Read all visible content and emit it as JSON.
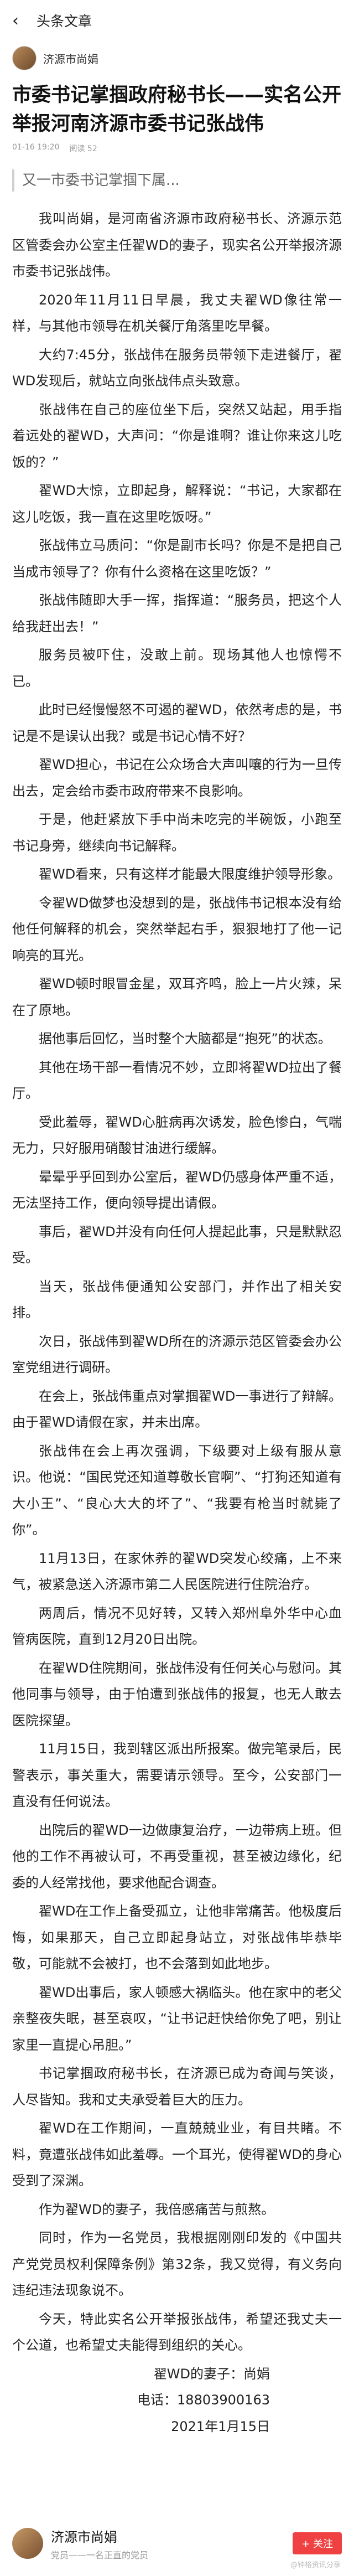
{
  "header": {
    "back_icon": "chevron-left-icon",
    "title": "头条文章"
  },
  "author": {
    "name": "济源市尚娟"
  },
  "article": {
    "title": "市委书记掌掴政府秘书长——实名公开举报河南济源市委书记张战伟",
    "date": "01-16 19:20",
    "reads": "阅读 52",
    "quote": "又一市委书记掌掴下属...",
    "paragraphs": [
      "我叫尚娟，是河南省济源市政府秘书长、济源示范区管委会办公室主任翟WD的妻子，现实名公开举报济源市委书记张战伟。",
      "2020年11月11日早晨，我丈夫翟WD像往常一样，与其他市领导在机关餐厅角落里吃早餐。",
      "大约7:45分，张战伟在服务员带领下走进餐厅，翟WD发现后，就站立向张战伟点头致意。",
      "张战伟在自己的座位坐下后，突然又站起，用手指着远处的翟WD，大声问：“你是谁啊？谁让你来这儿吃饭的？”",
      "翟WD大惊，立即起身，解释说：“书记，大家都在这儿吃饭，我一直在这里吃饭呀。”",
      "张战伟立马质问：“你是副市长吗？你是不是把自己当成市领导了？你有什么资格在这里吃饭？”",
      "张战伟随即大手一挥，指挥道：“服务员，把这个人给我赶出去！”",
      "服务员被吓住，没敢上前。现场其他人也惊愕不已。",
      "此时已经慢慢怒不可遏的翟WD，依然考虑的是，书记是不是误认出我？或是书记心情不好？",
      "翟WD担心，书记在公众场合大声叫嚷的行为一旦传出去，定会给市委市政府带来不良影响。",
      "于是，他赶紧放下手中尚未吃完的半碗饭，小跑至书记身旁，继续向书记解释。",
      "翟WD看来，只有这样才能最大限度维护领导形象。",
      "令翟WD做梦也没想到的是，张战伟书记根本没有给他任何解释的机会，突然举起右手，狠狠地打了他一记响亮的耳光。",
      "翟WD顿时眼冒金星，双耳齐鸣，脸上一片火辣，呆在了原地。",
      "据他事后回忆，当时整个大脑都是“抱死”的状态。",
      "其他在场干部一看情况不妙，立即将翟WD拉出了餐厅。",
      "受此羞辱，翟WD心脏病再次诱发，脸色惨白，气喘无力，只好服用硝酸甘油进行缓解。",
      "晕晕乎乎回到办公室后，翟WD仍感身体严重不适，无法坚持工作，便向领导提出请假。",
      "事后，翟WD并没有向任何人提起此事，只是默默忍受。",
      "当天，张战伟便通知公安部门，并作出了相关安排。",
      "次日，张战伟到翟WD所在的济源示范区管委会办公室党组进行调研。",
      "在会上，张战伟重点对掌掴翟WD一事进行了辩解。由于翟WD请假在家，并未出席。",
      "张战伟在会上再次强调，下级要对上级有服从意识。他说：“国民党还知道尊敬长官啊”、“打狗还知道有大小王”、“良心大大的坏了”、“我要有枪当时就毙了你”。",
      "11月13日，在家休养的翟WD突发心绞痛，上不来气，被紧急送入济源市第二人民医院进行住院治疗。",
      "两周后，情况不见好转，又转入郑州阜外华中心血管病医院，直到12月20日出院。",
      "在翟WD住院期间，张战伟没有任何关心与慰问。其他同事与领导，由于怕遭到张战伟的报复，也无人敢去医院探望。",
      "11月15日，我到辖区派出所报案。做完笔录后，民警表示，事关重大，需要请示领导。至今，公安部门一直没有任何说法。",
      "出院后的翟WD一边做康复治疗，一边带病上班。但他的工作不再被认可，不再受重视，甚至被边缘化，纪委的人经常找他，要求他配合调查。",
      "翟WD在工作上备受孤立，让他非常痛苦。他极度后悔，如果那天，自己立即起身站立，对张战伟毕恭毕敬，可能就不会被打，也不会落到如此地步。",
      "翟WD出事后，家人顿感大祸临头。他在家中的老父亲整夜失眠，甚至哀叹，“让书记赶快给你免了吧，别让家里一直提心吊胆。”",
      "书记掌掴政府秘书长，在济源已成为奇闻与笑谈，人尽皆知。我和丈夫承受着巨大的压力。",
      "翟WD在工作期间，一直兢兢业业，有目共睹。不料，竟遭张战伟如此羞辱。一个耳光，使得翟WD的身心受到了深渊。",
      "作为翟WD的妻子，我倍感痛苦与煎熬。",
      "同时，作为一名党员，我根据刚刚印发的《中国共产党党员权利保障条例》第32条，我又觉得，有义务向违纪违法现象说不。",
      "今天，特此实名公开举报张战伟，希望还我丈夫一个公道，也希望丈夫能得到组织的关心。"
    ],
    "signature": {
      "name": "翟WD的妻子：尚娟",
      "phone": "电话：18803900163",
      "date": "2021年1月15日"
    }
  },
  "footer_card": {
    "name": "济源市尚娟",
    "bio": "党员——一名正直的党员",
    "follow_label": "+ 关注"
  },
  "watermark": "@钟格资讯分享"
}
